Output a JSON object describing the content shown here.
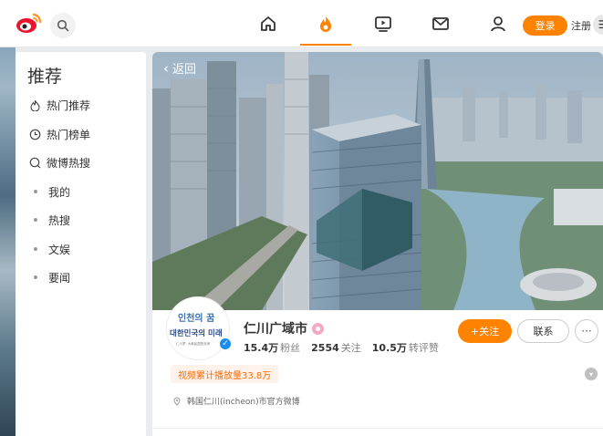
{
  "nav": {
    "login_label": "登录",
    "register_label": "注册",
    "more_label": "☰",
    "accent_color": "#ff8200",
    "icons": [
      "home-icon",
      "hot-icon",
      "video-icon",
      "mail-icon",
      "user-icon"
    ]
  },
  "sidebar": {
    "title": "推荐",
    "items": [
      {
        "label": "热门推荐",
        "icon": "hot-recommend-icon"
      },
      {
        "label": "热门榜单",
        "icon": "clock-icon"
      },
      {
        "label": "微博热搜",
        "icon": "search-icon"
      },
      {
        "label": "我的"
      },
      {
        "label": "热搜"
      },
      {
        "label": "文娱"
      },
      {
        "label": "要闻"
      }
    ]
  },
  "profile": {
    "back_label": "返回",
    "name": "仁川广域市",
    "followers_value": "15.4万",
    "followers_unit": "粉丝",
    "following_value": "2554",
    "following_unit": "关注",
    "likes_value": "10.5万",
    "likes_unit": "转评赞",
    "follow_label": "+关注",
    "contact_label": "联系",
    "more_label": "···",
    "views_tag": "视频累计播放量33.8万",
    "location": "韩国仁川(incheon)市官方微博",
    "avatar_text_1": "인천의 꿈",
    "avatar_text_2": "대한민국의 미래",
    "avatar_text_3": "仁川梦, 大韩民国的未来"
  }
}
